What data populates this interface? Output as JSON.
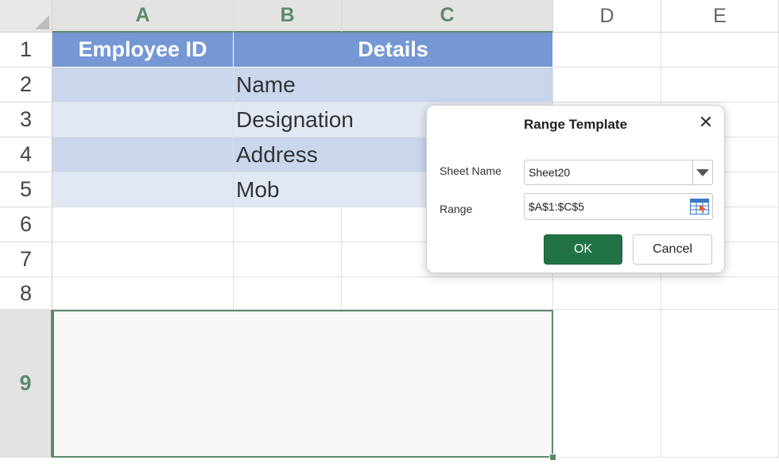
{
  "columns": [
    "A",
    "B",
    "C",
    "D",
    "E"
  ],
  "rows": [
    "1",
    "2",
    "3",
    "4",
    "5",
    "6",
    "7",
    "8",
    "9"
  ],
  "table": {
    "header_employee_id": "Employee ID",
    "header_details": "Details",
    "detail_items": [
      "Name",
      "Designation",
      "Address",
      "Mob"
    ]
  },
  "dialog": {
    "title": "Range Template",
    "sheet_name_label": "Sheet Name",
    "sheet_name_value": "Sheet20",
    "range_label": "Range",
    "range_value": "$A$1:$C$5",
    "ok_label": "OK",
    "cancel_label": "Cancel",
    "close_glyph": "✕"
  },
  "colors": {
    "accent_green": "#217346",
    "header_blue": "#7598d4",
    "band_dark": "#c9d6ec",
    "band_light": "#e1e8f4",
    "selection_green": "#5b8a6c"
  },
  "icons": {
    "close": "close-icon",
    "dropdown": "chevron-down-icon",
    "range_select": "range-select-icon"
  }
}
